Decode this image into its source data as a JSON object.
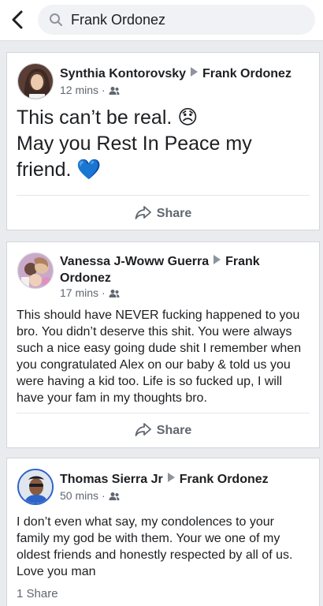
{
  "search": {
    "value": "Frank Ordonez"
  },
  "posts": [
    {
      "author": "Synthia Kontorovsky",
      "target": "Frank Ordonez",
      "time": "12 mins",
      "lines": [
        "This can’t be real. 😞",
        "May you Rest In Peace my",
        "friend. 💙"
      ],
      "share_label": "Share"
    },
    {
      "author": "Vanessa J-Woww Guerra",
      "target_line1": "Frank",
      "target_line2": "Ordonez",
      "time": "17 mins",
      "lines": [
        "This should have NEVER fucking happened to you",
        "bro. You didn’t deserve this shit. You were always",
        "such a nice easy going dude shit I remember when",
        "you congratulated Alex on our baby & told us you",
        "were having a kid too. Life is so fucked up, I will",
        "have your fam in my thoughts bro."
      ],
      "share_label": "Share"
    },
    {
      "author": "Thomas Sierra Jr",
      "target": "Frank Ordonez",
      "time": "50 mins",
      "lines": [
        "I don’t even what say, my condolences to your",
        "family my god be with them. Your we one of my",
        "oldest friends and honestly respected by all of us.",
        "Love you man"
      ],
      "share_count": "1 Share"
    }
  ],
  "icons": {
    "back": "back-arrow-icon",
    "search": "search-icon",
    "audience": "friends-icon",
    "share": "share-icon"
  }
}
